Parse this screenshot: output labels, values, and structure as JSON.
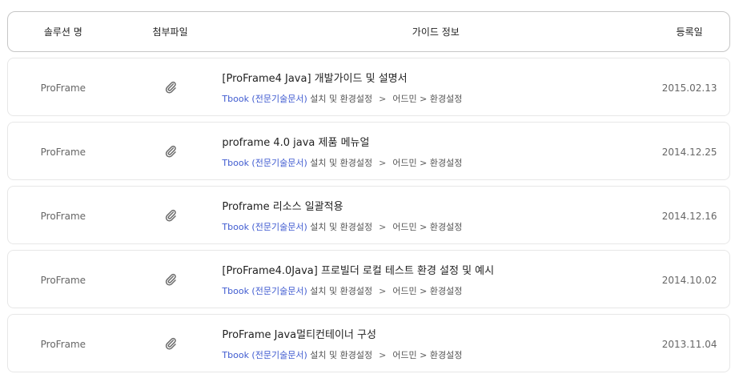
{
  "header": {
    "solution": "솔루션 명",
    "attachment": "첨부파일",
    "guide_info": "가이드 정보",
    "date": "등록일"
  },
  "rows": [
    {
      "solution": "ProFrame",
      "title": "[ProFrame4 Java] 개발가이드 및 설명서",
      "category_link": "Tbook (전문기술문서)",
      "category_mid": "설치 및 환경설정",
      "separator": ">",
      "category_end": "어드민 > 환경설정",
      "date": "2015.02.13"
    },
    {
      "solution": "ProFrame",
      "title": "proframe 4.0 java 제품 메뉴얼",
      "category_link": "Tbook (전문기술문서)",
      "category_mid": "설치 및 환경설정",
      "separator": ">",
      "category_end": "어드민 > 환경설정",
      "date": "2014.12.25"
    },
    {
      "solution": "ProFrame",
      "title": "Proframe 리소스 일괄적용",
      "category_link": "Tbook (전문기술문서)",
      "category_mid": "설치 및 환경설정",
      "separator": ">",
      "category_end": "어드민 > 환경설정",
      "date": "2014.12.16"
    },
    {
      "solution": "ProFrame",
      "title": "[ProFrame4.0Java] 프로빌더 로컬 테스트 환경 설정 및 예시",
      "category_link": "Tbook (전문기술문서)",
      "category_mid": "설치 및 환경설정",
      "separator": ">",
      "category_end": "어드민 > 환경설정",
      "date": "2014.10.02"
    },
    {
      "solution": "ProFrame",
      "title": "ProFrame Java멀티컨테이너 구성",
      "category_link": "Tbook (전문기술문서)",
      "category_mid": "설치 및 환경설정",
      "separator": ">",
      "category_end": "어드민 > 환경설정",
      "date": "2013.11.04"
    }
  ],
  "icons": {
    "attachment": "paperclip-icon"
  },
  "colors": {
    "link": "#3f5bd0",
    "border": "#e7e7e7",
    "header_border": "#c6c6c6"
  }
}
